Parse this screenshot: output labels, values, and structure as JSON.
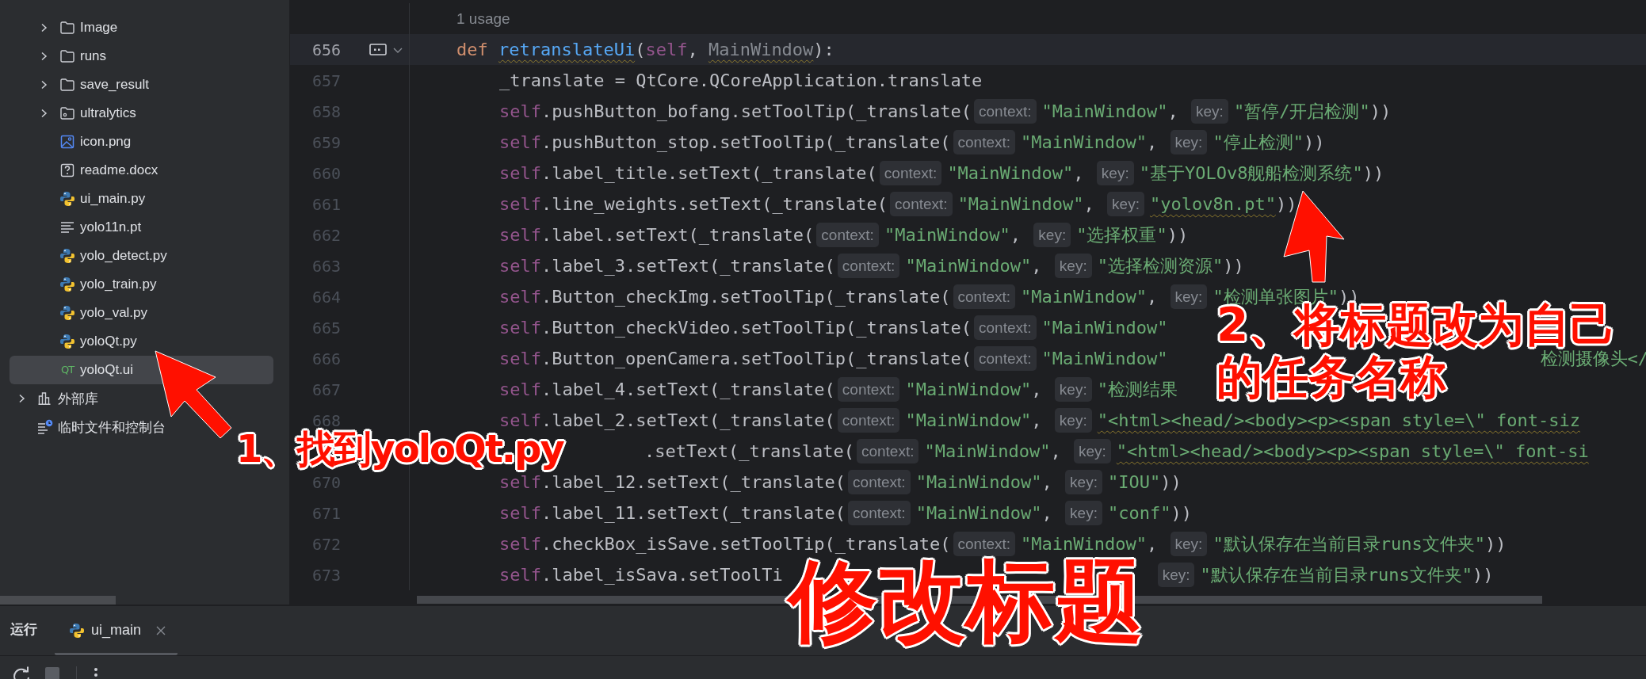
{
  "sidebar": {
    "project_items": [
      {
        "name": "Image",
        "kind": "folder",
        "expanded": false,
        "selected": false
      },
      {
        "name": "runs",
        "kind": "folder",
        "expanded": false,
        "selected": false
      },
      {
        "name": "save_result",
        "kind": "folder",
        "expanded": false,
        "selected": false
      },
      {
        "name": "ultralytics",
        "kind": "package",
        "expanded": false,
        "selected": false
      },
      {
        "name": "icon.png",
        "kind": "image",
        "selected": false
      },
      {
        "name": "readme.docx",
        "kind": "unknown",
        "selected": false
      },
      {
        "name": "ui_main.py",
        "kind": "python",
        "selected": false
      },
      {
        "name": "yolo11n.pt",
        "kind": "text",
        "selected": false
      },
      {
        "name": "yolo_detect.py",
        "kind": "python",
        "selected": false
      },
      {
        "name": "yolo_train.py",
        "kind": "python",
        "selected": false
      },
      {
        "name": "yolo_val.py",
        "kind": "python",
        "selected": false
      },
      {
        "name": "yoloQt.py",
        "kind": "python",
        "selected": false
      },
      {
        "name": "yoloQt.ui",
        "kind": "qt",
        "icon_label": "QT",
        "selected": true
      }
    ],
    "root_items": [
      {
        "name": "外部库",
        "kind": "library",
        "expanded": false,
        "selected": false
      },
      {
        "name": "临时文件和控制台",
        "kind": "scratches",
        "selected": false
      }
    ]
  },
  "editor": {
    "usage_hint": "1 usage",
    "lines": [
      {
        "num": "656",
        "current": true,
        "foldable": true,
        "tokens": [
          {
            "kind": "kw",
            "text": "def"
          },
          {
            "kind": "fn",
            "text": "retranslateUi",
            "warning": true
          },
          {
            "kind": "plain",
            "text": "("
          },
          {
            "kind": "self",
            "text": "self"
          },
          {
            "kind": "plain",
            "text": ", "
          },
          {
            "kind": "param",
            "text": "MainWindow",
            "warning": true
          },
          {
            "kind": "plain",
            "text": "):"
          }
        ],
        "children": [
          {
            "num": "657",
            "tokens": [
              {
                "kind": "plain",
                "text": "_translate = QtCore.QCoreApplication.translate"
              }
            ]
          },
          {
            "num": "658",
            "tokens": [
              {
                "kind": "self",
                "text": "self"
              },
              {
                "kind": "plain",
                "text": ".pushButton_bofang.setToolTip(_translate("
              },
              {
                "kind": "hint",
                "text": "context:"
              },
              {
                "kind": "str",
                "text": "\"MainWindow\""
              },
              {
                "kind": "plain",
                "text": ", "
              },
              {
                "kind": "hint",
                "text": "key:"
              },
              {
                "kind": "str",
                "text": "\"暂停/开启检测\""
              },
              {
                "kind": "plain",
                "text": "))"
              }
            ]
          },
          {
            "num": "659",
            "tokens": [
              {
                "kind": "self",
                "text": "self"
              },
              {
                "kind": "plain",
                "text": ".pushButton_stop.setToolTip(_translate("
              },
              {
                "kind": "hint",
                "text": "context:"
              },
              {
                "kind": "str",
                "text": "\"MainWindow\""
              },
              {
                "kind": "plain",
                "text": ", "
              },
              {
                "kind": "hint",
                "text": "key:"
              },
              {
                "kind": "str",
                "text": "\"停止检测\""
              },
              {
                "kind": "plain",
                "text": "))"
              }
            ]
          },
          {
            "num": "660",
            "tokens": [
              {
                "kind": "self",
                "text": "self"
              },
              {
                "kind": "plain",
                "text": ".label_title.setText(_translate("
              },
              {
                "kind": "hint",
                "text": "context:"
              },
              {
                "kind": "str",
                "text": "\"MainWindow\""
              },
              {
                "kind": "plain",
                "text": ", "
              },
              {
                "kind": "hint",
                "text": "key:"
              },
              {
                "kind": "str",
                "text": "\"基于YOLOv8舰船检测系统\""
              },
              {
                "kind": "plain",
                "text": "))"
              }
            ]
          },
          {
            "num": "661",
            "tokens": [
              {
                "kind": "self",
                "text": "self"
              },
              {
                "kind": "plain",
                "text": ".line_weights.setText(_translate("
              },
              {
                "kind": "hint",
                "text": "context:"
              },
              {
                "kind": "str",
                "text": "\"MainWindow\""
              },
              {
                "kind": "plain",
                "text": ", "
              },
              {
                "kind": "hint",
                "text": "key:"
              },
              {
                "kind": "str",
                "text": "\"yolov8n.pt\"",
                "warning": true
              },
              {
                "kind": "plain",
                "text": "))"
              }
            ]
          },
          {
            "num": "662",
            "tokens": [
              {
                "kind": "self",
                "text": "self"
              },
              {
                "kind": "plain",
                "text": ".label.setText(_translate("
              },
              {
                "kind": "hint",
                "text": "context:"
              },
              {
                "kind": "str",
                "text": "\"MainWindow\""
              },
              {
                "kind": "plain",
                "text": ", "
              },
              {
                "kind": "hint",
                "text": "key:"
              },
              {
                "kind": "str",
                "text": "\"选择权重\""
              },
              {
                "kind": "plain",
                "text": "))"
              }
            ]
          },
          {
            "num": "663",
            "tokens": [
              {
                "kind": "self",
                "text": "self"
              },
              {
                "kind": "plain",
                "text": ".label_3.setText(_translate("
              },
              {
                "kind": "hint",
                "text": "context:"
              },
              {
                "kind": "str",
                "text": "\"MainWindow\""
              },
              {
                "kind": "plain",
                "text": ", "
              },
              {
                "kind": "hint",
                "text": "key:"
              },
              {
                "kind": "str",
                "text": "\"选择检测资源\""
              },
              {
                "kind": "plain",
                "text": "))"
              }
            ]
          },
          {
            "num": "664",
            "tokens": [
              {
                "kind": "self",
                "text": "self"
              },
              {
                "kind": "plain",
                "text": ".Button_checkImg.setToolTip(_translate("
              },
              {
                "kind": "hint",
                "text": "context:"
              },
              {
                "kind": "str",
                "text": "\"MainWindow\""
              },
              {
                "kind": "plain",
                "text": ", "
              },
              {
                "kind": "hint",
                "text": "key:"
              },
              {
                "kind": "str",
                "text": "\"检测单张图片\""
              },
              {
                "kind": "plain",
                "text": "))"
              }
            ]
          },
          {
            "num": "665",
            "tokens": [
              {
                "kind": "self",
                "text": "self"
              },
              {
                "kind": "plain",
                "text": ".Button_checkVideo.setToolTip(_translate("
              },
              {
                "kind": "hint",
                "text": "context:"
              },
              {
                "kind": "str",
                "text": "\"MainWindow\""
              }
            ]
          },
          {
            "num": "666",
            "tokens": [
              {
                "kind": "self",
                "text": "self"
              },
              {
                "kind": "plain",
                "text": ".Button_openCamera.setToolTip(_translate("
              },
              {
                "kind": "hint",
                "text": "context:"
              },
              {
                "kind": "str",
                "text": "\"MainWindow\""
              },
              {
                "kind": "covered_mid"
              },
              {
                "kind": "str",
                "text": "检测摄像头</"
              }
            ]
          },
          {
            "num": "667",
            "tokens": [
              {
                "kind": "self",
                "text": "self"
              },
              {
                "kind": "plain",
                "text": ".label_4.setText(_translate("
              },
              {
                "kind": "hint",
                "text": "context:"
              },
              {
                "kind": "str",
                "text": "\"MainWindow\""
              },
              {
                "kind": "plain",
                "text": ", "
              },
              {
                "kind": "hint",
                "text": "key:"
              },
              {
                "kind": "str",
                "text": "\"检测结果"
              }
            ]
          },
          {
            "num": "668",
            "tokens": [
              {
                "kind": "self",
                "text": "self"
              },
              {
                "kind": "plain",
                "text": ".label_2.setText(_translate("
              },
              {
                "kind": "hint",
                "text": "context:"
              },
              {
                "kind": "str",
                "text": "\"MainWindow\""
              },
              {
                "kind": "plain",
                "text": ", "
              },
              {
                "kind": "hint",
                "text": "key:"
              },
              {
                "kind": "str",
                "text": "\"<html><head/><body><p><span style=\\\" font-siz",
                "warning": true
              }
            ]
          },
          {
            "tokens": [
              {
                "kind": "covered_start"
              },
              {
                "kind": "plain",
                "text": ".setText(_translate("
              },
              {
                "kind": "hint",
                "text": "context:"
              },
              {
                "kind": "str",
                "text": "\"MainWindow\""
              },
              {
                "kind": "plain",
                "text": ", "
              },
              {
                "kind": "hint",
                "text": "key:"
              },
              {
                "kind": "str",
                "text": "\"<html><head/><body><p><span style=\\\" font-si",
                "warning": true
              }
            ]
          },
          {
            "num": "670",
            "tokens": [
              {
                "kind": "self",
                "text": "self"
              },
              {
                "kind": "plain",
                "text": ".label_12.setText(_translate("
              },
              {
                "kind": "hint",
                "text": "context:"
              },
              {
                "kind": "str",
                "text": "\"MainWindow\""
              },
              {
                "kind": "plain",
                "text": ", "
              },
              {
                "kind": "hint",
                "text": "key:"
              },
              {
                "kind": "str",
                "text": "\"IOU\""
              },
              {
                "kind": "plain",
                "text": "))"
              }
            ]
          },
          {
            "num": "671",
            "tokens": [
              {
                "kind": "self",
                "text": "self"
              },
              {
                "kind": "plain",
                "text": ".label_11.setText(_translate("
              },
              {
                "kind": "hint",
                "text": "context:"
              },
              {
                "kind": "str",
                "text": "\"MainWindow\""
              },
              {
                "kind": "plain",
                "text": ", "
              },
              {
                "kind": "hint",
                "text": "key:"
              },
              {
                "kind": "str",
                "text": "\"conf\""
              },
              {
                "kind": "plain",
                "text": "))"
              }
            ]
          },
          {
            "num": "672",
            "tokens": [
              {
                "kind": "self",
                "text": "self"
              },
              {
                "kind": "plain",
                "text": ".checkBox_isSave.setToolTip(_translate("
              },
              {
                "kind": "hint",
                "text": "context:"
              },
              {
                "kind": "str",
                "text": "\"MainWindow\""
              },
              {
                "kind": "plain",
                "text": ", "
              },
              {
                "kind": "hint",
                "text": "key:"
              },
              {
                "kind": "str",
                "text": "\"默认保存在当前目录runs文件夹\""
              },
              {
                "kind": "plain",
                "text": "))"
              }
            ]
          },
          {
            "num": "673",
            "tokens": [
              {
                "kind": "self",
                "text": "self"
              },
              {
                "kind": "plain",
                "text": ".label_isSava.setToolTi"
              },
              {
                "kind": "covered_mid"
              },
              {
                "kind": "hint",
                "text": "key:"
              },
              {
                "kind": "str",
                "text": "\"默认保存在当前目录runs文件夹\""
              },
              {
                "kind": "plain",
                "text": "))"
              }
            ]
          }
        ]
      }
    ]
  },
  "run_panel": {
    "title": "运行",
    "tabs": [
      {
        "label": "ui_main",
        "selected": true
      }
    ]
  },
  "annotations": [
    {
      "kind": "callout",
      "lines": [
        "1、找到yoloQt.py"
      ]
    },
    {
      "kind": "callout",
      "lines": [
        "2、将标题改为自己",
        "的任务名称"
      ]
    },
    {
      "kind": "headline",
      "lines": [
        "修改标题"
      ]
    }
  ]
}
